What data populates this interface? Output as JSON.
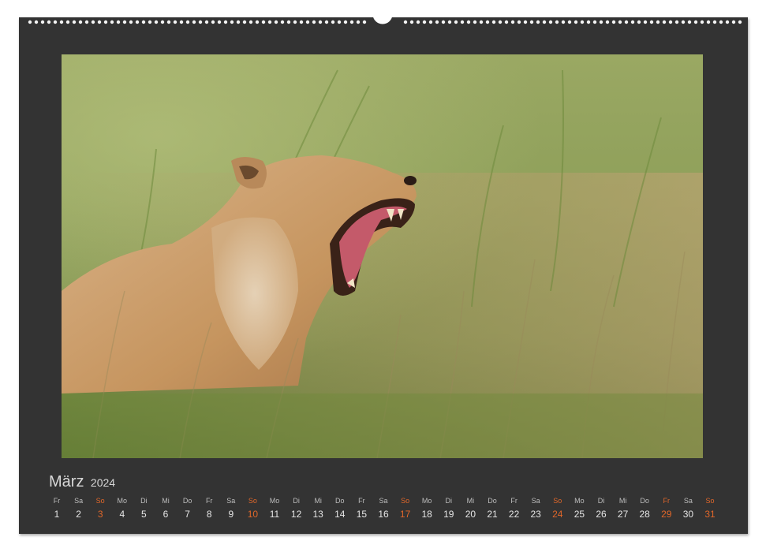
{
  "calendar": {
    "month": "März",
    "year": "2024",
    "accent_color": "#e0672a",
    "days": [
      {
        "wd": "Fr",
        "num": "1",
        "red": false
      },
      {
        "wd": "Sa",
        "num": "2",
        "red": false
      },
      {
        "wd": "So",
        "num": "3",
        "red": true
      },
      {
        "wd": "Mo",
        "num": "4",
        "red": false
      },
      {
        "wd": "Di",
        "num": "5",
        "red": false
      },
      {
        "wd": "Mi",
        "num": "6",
        "red": false
      },
      {
        "wd": "Do",
        "num": "7",
        "red": false
      },
      {
        "wd": "Fr",
        "num": "8",
        "red": false
      },
      {
        "wd": "Sa",
        "num": "9",
        "red": false
      },
      {
        "wd": "So",
        "num": "10",
        "red": true
      },
      {
        "wd": "Mo",
        "num": "11",
        "red": false
      },
      {
        "wd": "Di",
        "num": "12",
        "red": false
      },
      {
        "wd": "Mi",
        "num": "13",
        "red": false
      },
      {
        "wd": "Do",
        "num": "14",
        "red": false
      },
      {
        "wd": "Fr",
        "num": "15",
        "red": false
      },
      {
        "wd": "Sa",
        "num": "16",
        "red": false
      },
      {
        "wd": "So",
        "num": "17",
        "red": true
      },
      {
        "wd": "Mo",
        "num": "18",
        "red": false
      },
      {
        "wd": "Di",
        "num": "19",
        "red": false
      },
      {
        "wd": "Mi",
        "num": "20",
        "red": false
      },
      {
        "wd": "Do",
        "num": "21",
        "red": false
      },
      {
        "wd": "Fr",
        "num": "22",
        "red": false
      },
      {
        "wd": "Sa",
        "num": "23",
        "red": false
      },
      {
        "wd": "So",
        "num": "24",
        "red": true
      },
      {
        "wd": "Mo",
        "num": "25",
        "red": false
      },
      {
        "wd": "Di",
        "num": "26",
        "red": false
      },
      {
        "wd": "Mi",
        "num": "27",
        "red": false
      },
      {
        "wd": "Do",
        "num": "28",
        "red": false
      },
      {
        "wd": "Fr",
        "num": "29",
        "red": true
      },
      {
        "wd": "Sa",
        "num": "30",
        "red": false
      },
      {
        "wd": "So",
        "num": "31",
        "red": true
      }
    ]
  },
  "photo": {
    "subject": "yawning-lioness-in-grass",
    "palette": {
      "grass_light": "#a3b168",
      "grass_dark": "#5f7a34",
      "grass_dry": "#b59a6c",
      "fur": "#c99a6a",
      "fur_light": "#e2c9a6",
      "mouth": "#c45a6a"
    }
  },
  "frame": {
    "sheet_color": "#333333",
    "binding": "wire-o"
  }
}
